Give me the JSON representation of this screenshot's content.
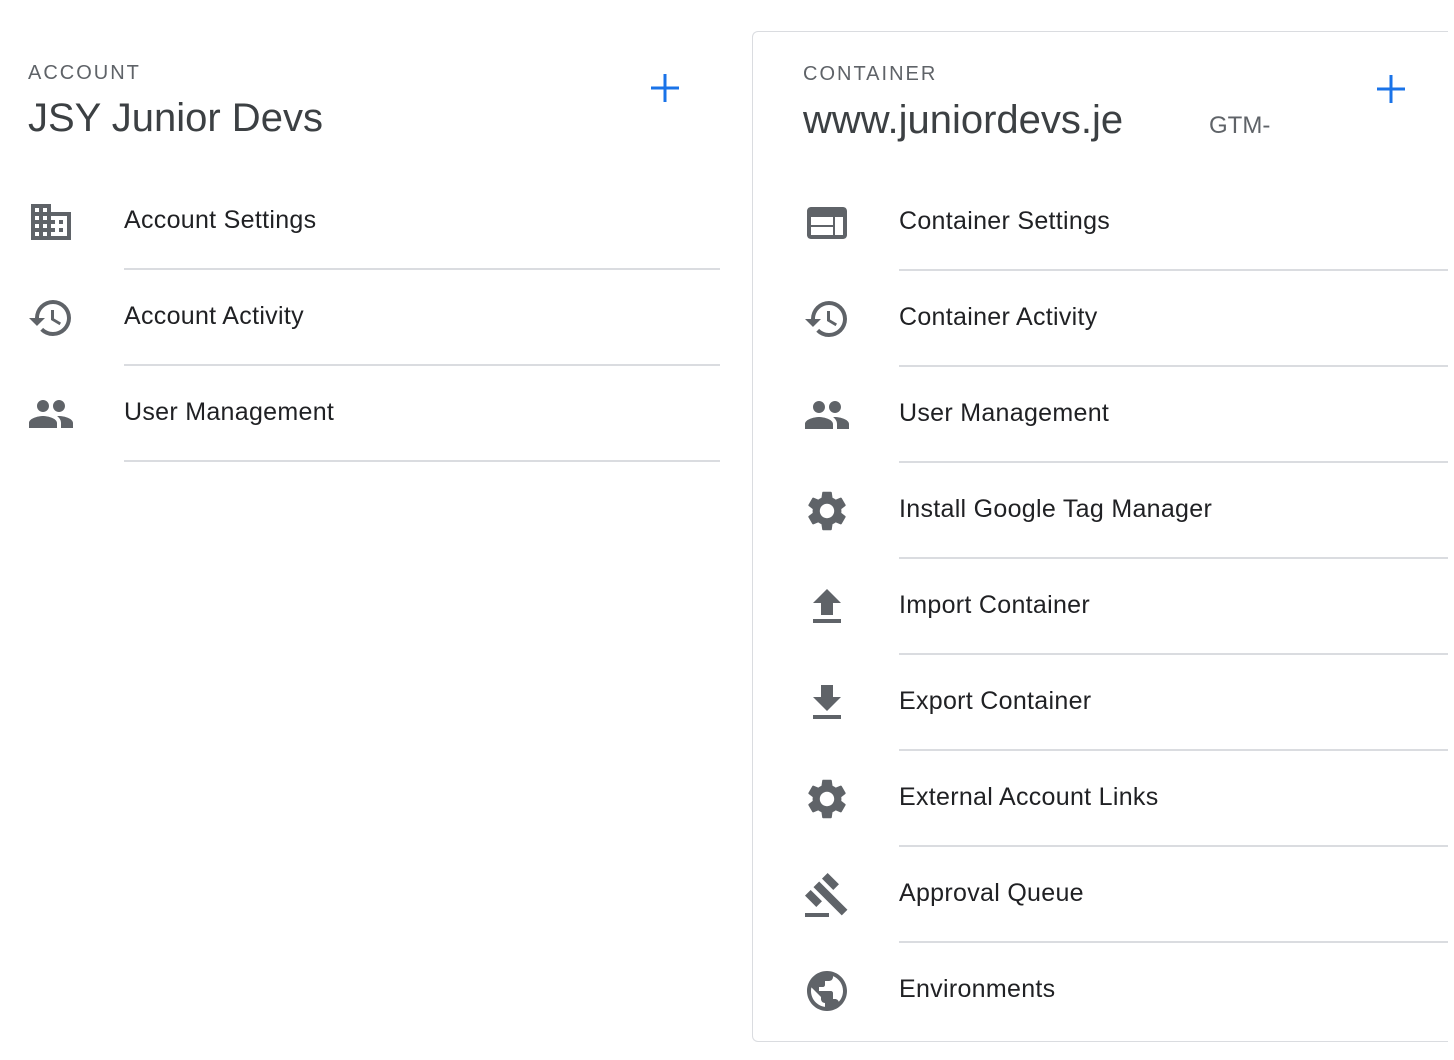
{
  "account": {
    "section_label": "ACCOUNT",
    "name": "JSY Junior Devs",
    "add_icon": "plus-icon",
    "items": [
      {
        "label": "Account Settings",
        "icon": "building-icon"
      },
      {
        "label": "Account Activity",
        "icon": "history-icon"
      },
      {
        "label": "User Management",
        "icon": "people-icon"
      }
    ]
  },
  "container": {
    "section_label": "CONTAINER",
    "name": "www.juniordevs.je",
    "container_id": "GTM-",
    "add_icon": "plus-icon",
    "items": [
      {
        "label": "Container Settings",
        "icon": "web-layout-icon"
      },
      {
        "label": "Container Activity",
        "icon": "history-icon"
      },
      {
        "label": "User Management",
        "icon": "people-icon"
      },
      {
        "label": "Install Google Tag Manager",
        "icon": "gear-icon"
      },
      {
        "label": "Import Container",
        "icon": "upload-icon"
      },
      {
        "label": "Export Container",
        "icon": "download-icon"
      },
      {
        "label": "External Account Links",
        "icon": "gear-icon"
      },
      {
        "label": "Approval Queue",
        "icon": "gavel-icon"
      },
      {
        "label": "Environments",
        "icon": "globe-icon"
      }
    ]
  },
  "colors": {
    "accent": "#1a73e8",
    "icon": "#5f6368",
    "divider": "#dadce0",
    "text": "#202124"
  }
}
